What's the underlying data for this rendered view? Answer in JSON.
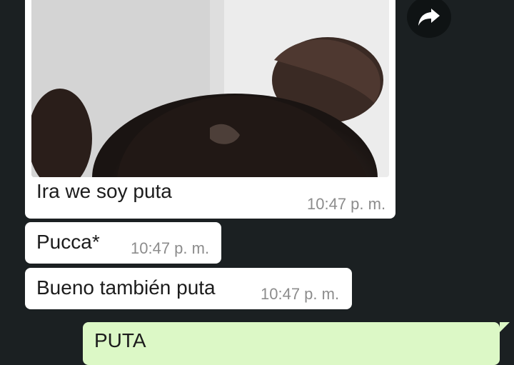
{
  "chat": {
    "messages": [
      {
        "type": "image",
        "caption": "Ira we soy puta",
        "time": "10:47 p. m."
      },
      {
        "type": "text",
        "text": "Pucca*",
        "time": "10:47 p. m."
      },
      {
        "type": "text",
        "text": "Bueno también puta",
        "time": "10:47 p. m."
      },
      {
        "type": "text",
        "direction": "outgoing",
        "text": "PUTA"
      }
    ],
    "share_icon": "share-arrow-icon"
  },
  "colors": {
    "background": "#1b2022",
    "incoming_bubble": "#ffffff",
    "outgoing_bubble": "#dcf8c6",
    "timestamp": "#8c8c8c",
    "share_button_bg": "#0f1314"
  }
}
